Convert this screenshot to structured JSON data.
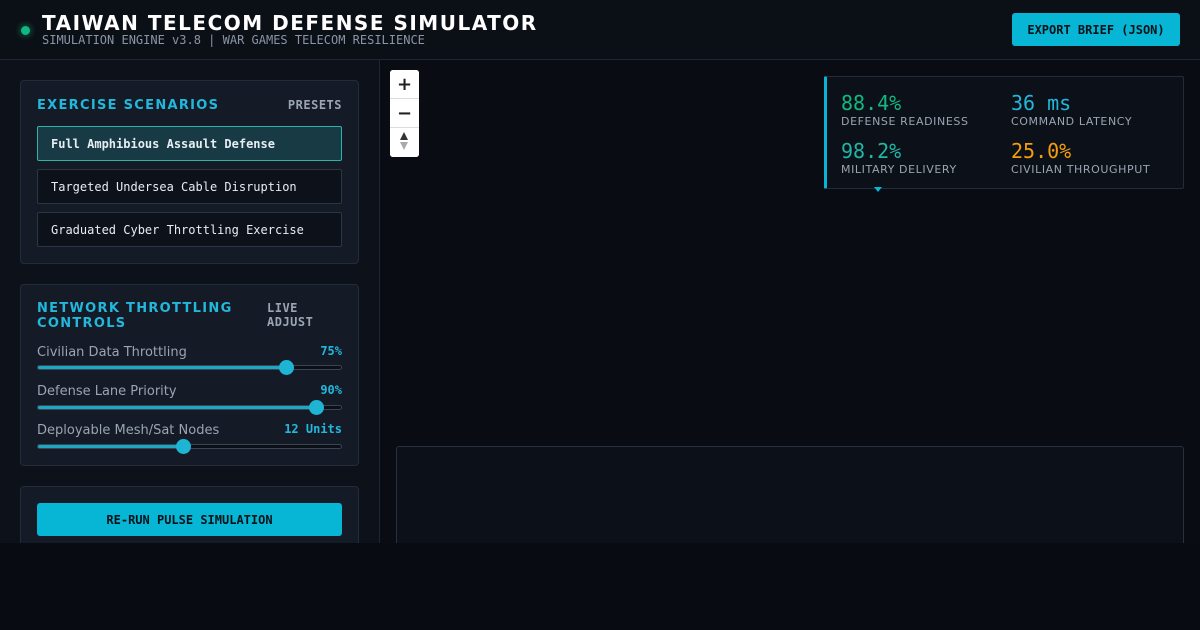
{
  "header": {
    "title": "TAIWAN TELECOM DEFENSE SIMULATOR",
    "subtitle": "SIMULATION ENGINE v3.8 | WAR GAMES TELECOM RESILIENCE",
    "export_label": "EXPORT BRIEF (JSON)",
    "status_color": "#10b981"
  },
  "scenarios": {
    "title": "EXERCISE SCENARIOS",
    "tag": "PRESETS",
    "items": [
      {
        "label": "Full Amphibious Assault Defense",
        "active": true
      },
      {
        "label": "Targeted Undersea Cable Disruption",
        "active": false
      },
      {
        "label": "Graduated Cyber Throttling Exercise",
        "active": false
      }
    ]
  },
  "throttling": {
    "title_line1": "NETWORK THROTTLING",
    "title_line2": "CONTROLS",
    "tag_line1": "LIVE",
    "tag_line2": "ADJUST",
    "sliders": [
      {
        "label": "Civilian Data Throttling",
        "value_text": "75%",
        "fraction": 0.82
      },
      {
        "label": "Defense Lane Priority",
        "value_text": "90%",
        "fraction": 0.918
      },
      {
        "label": "Deployable Mesh/Sat Nodes",
        "value_text": "12 Units",
        "fraction": 0.48
      }
    ]
  },
  "action": {
    "rerun_label": "RE-RUN PULSE SIMULATION"
  },
  "map": {
    "zoom_in_icon": "+",
    "zoom_out_icon": "−",
    "compass_icon": "compass-icon"
  },
  "metrics": {
    "defense_readiness": {
      "value": "88.4%",
      "label": "DEFENSE READINESS",
      "color": "#10b981"
    },
    "command_latency": {
      "value": "36 ms",
      "label": "COMMAND LATENCY",
      "color": "#22b8dc"
    },
    "military_delivery": {
      "value": "98.2%",
      "label": "MILITARY DELIVERY",
      "color": "#1fb8a6"
    },
    "civilian_throughput": {
      "value": "25.0%",
      "label": "CIVILIAN THROUGHPUT",
      "color": "#f59e0b"
    }
  },
  "colors": {
    "accent": "#06b6d4",
    "background": "#090c12"
  }
}
